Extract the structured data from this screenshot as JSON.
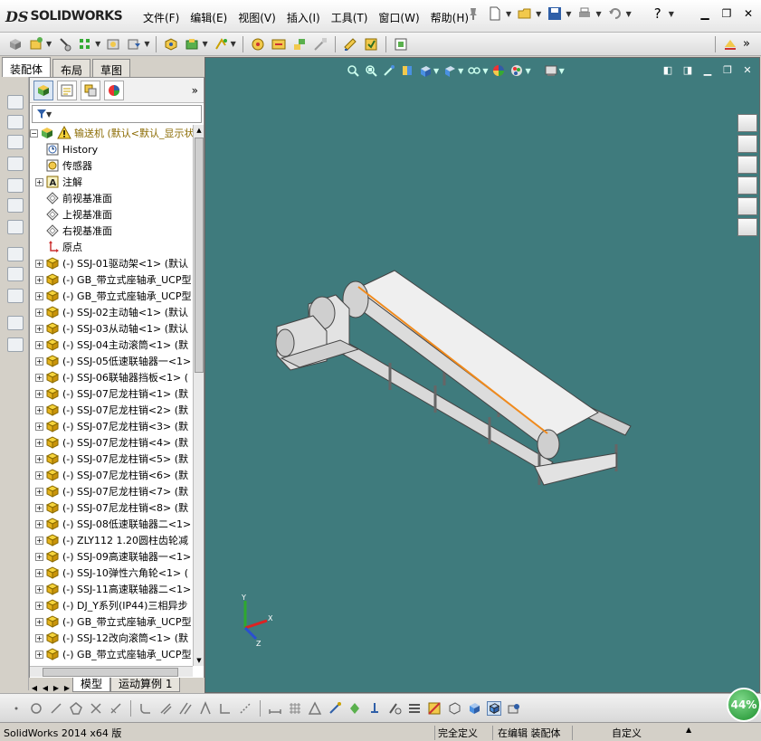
{
  "app": {
    "logo_ds": "DS",
    "logo_name": "SOLIDWORKS",
    "menu": [
      "文件(F)",
      "编辑(E)",
      "视图(V)",
      "插入(I)",
      "工具(T)",
      "窗口(W)",
      "帮助(H)"
    ]
  },
  "left_tabs": [
    "装配体",
    "布局",
    "草图"
  ],
  "feature_tree": {
    "root": "输送机 (默认<默认_显示状",
    "items": [
      {
        "label": "History",
        "icon": "history-icon",
        "expand": false
      },
      {
        "label": "传感器",
        "icon": "sensor-icon",
        "expand": false
      },
      {
        "label": "注解",
        "icon": "annotation-icon",
        "expand": true
      },
      {
        "label": "前视基准面",
        "icon": "plane-icon",
        "expand": false
      },
      {
        "label": "上视基准面",
        "icon": "plane-icon",
        "expand": false
      },
      {
        "label": "右视基准面",
        "icon": "plane-icon",
        "expand": false
      },
      {
        "label": "原点",
        "icon": "origin-icon",
        "expand": false
      },
      {
        "label": "(-) SSJ-01驱动架<1> (默认",
        "icon": "part-icon",
        "expand": true
      },
      {
        "label": "(-) GB_带立式座轴承_UCP型",
        "icon": "part-icon",
        "expand": true
      },
      {
        "label": "(-) GB_带立式座轴承_UCP型",
        "icon": "part-icon",
        "expand": true
      },
      {
        "label": "(-) SSJ-02主动轴<1> (默认",
        "icon": "part-icon",
        "expand": true
      },
      {
        "label": "(-) SSJ-03从动轴<1> (默认",
        "icon": "part-icon",
        "expand": true
      },
      {
        "label": "(-) SSJ-04主动滚筒<1> (默",
        "icon": "part-icon",
        "expand": true
      },
      {
        "label": "(-) SSJ-05低速联轴器一<1>",
        "icon": "part-icon",
        "expand": true
      },
      {
        "label": "(-) SSJ-06联轴器挡板<1> (",
        "icon": "part-icon",
        "expand": true
      },
      {
        "label": "(-) SSJ-07尼龙柱销<1> (默",
        "icon": "part-icon",
        "expand": true
      },
      {
        "label": "(-) SSJ-07尼龙柱销<2> (默",
        "icon": "part-icon",
        "expand": true
      },
      {
        "label": "(-) SSJ-07尼龙柱销<3> (默",
        "icon": "part-icon",
        "expand": true
      },
      {
        "label": "(-) SSJ-07尼龙柱销<4> (默",
        "icon": "part-icon",
        "expand": true
      },
      {
        "label": "(-) SSJ-07尼龙柱销<5> (默",
        "icon": "part-icon",
        "expand": true
      },
      {
        "label": "(-) SSJ-07尼龙柱销<6> (默",
        "icon": "part-icon",
        "expand": true
      },
      {
        "label": "(-) SSJ-07尼龙柱销<7> (默",
        "icon": "part-icon",
        "expand": true
      },
      {
        "label": "(-) SSJ-07尼龙柱销<8> (默",
        "icon": "part-icon",
        "expand": true
      },
      {
        "label": "(-) SSJ-08低速联轴器二<1>",
        "icon": "part-icon",
        "expand": true
      },
      {
        "label": "(-) ZLY112 1.20圆柱齿轮减",
        "icon": "part-icon",
        "expand": true
      },
      {
        "label": "(-) SSJ-09高速联轴器一<1>",
        "icon": "part-icon",
        "expand": true
      },
      {
        "label": "(-) SSJ-10弹性六角轮<1> (",
        "icon": "part-icon",
        "expand": true
      },
      {
        "label": "(-) SSJ-11高速联轴器二<1>",
        "icon": "part-icon",
        "expand": true
      },
      {
        "label": "(-) DJ_Y系列(IP44)三相异步",
        "icon": "part-icon",
        "expand": true
      },
      {
        "label": "(-) GB_带立式座轴承_UCP型",
        "icon": "part-icon",
        "expand": true
      },
      {
        "label": "(-) SSJ-12改向滚筒<1> (默",
        "icon": "part-icon",
        "expand": true
      },
      {
        "label": "(-) GB_带立式座轴承_UCP型",
        "icon": "part-icon",
        "expand": true
      }
    ]
  },
  "bottom_tabs": [
    "模型",
    "运动算例 1"
  ],
  "status": {
    "version": "SolidWorks 2014 x64 版",
    "defined": "完全定义",
    "editing": "在编辑 装配体",
    "custom": "自定义"
  },
  "zoom_badge": "44%",
  "colors": {
    "viewport_bg": "#3f7b7d",
    "accent_orange": "#f08a1c"
  }
}
